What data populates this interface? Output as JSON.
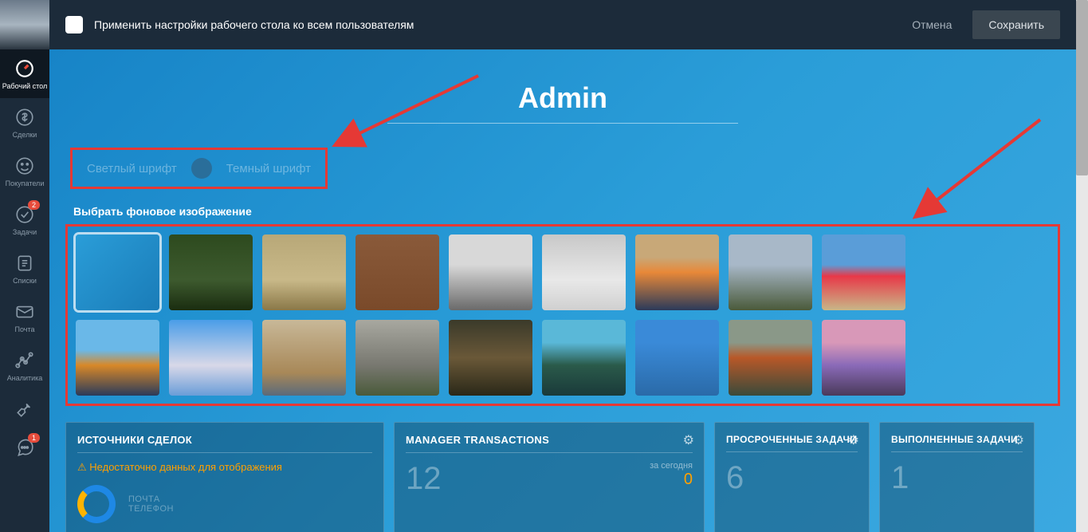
{
  "topbar": {
    "apply_label": "Применить настройки рабочего стола ко всем пользователям",
    "cancel": "Отмена",
    "save": "Сохранить"
  },
  "sidebar": {
    "items": [
      {
        "label": "Рабочий стол",
        "icon": "gauge",
        "active": true
      },
      {
        "label": "Сделки",
        "icon": "dollar"
      },
      {
        "label": "Покупатели",
        "icon": "smile"
      },
      {
        "label": "Задачи",
        "icon": "check",
        "badge": "2"
      },
      {
        "label": "Списки",
        "icon": "list"
      },
      {
        "label": "Почта",
        "icon": "mail"
      },
      {
        "label": "Аналитика",
        "icon": "chart"
      },
      {
        "label": "",
        "icon": "wrench"
      },
      {
        "label": "",
        "icon": "chat",
        "badge": "1"
      }
    ]
  },
  "page": {
    "title": "Admin",
    "font_toggle": {
      "light": "Светлый шрифт",
      "dark": "Темный шрифт"
    },
    "bg_label": "Выбрать фоновое изображение",
    "thumbs": [
      {
        "g": "linear-gradient(135deg,#2a9dd8,#1a7cb8)",
        "selected": true
      },
      {
        "g": "linear-gradient(#2d4a1e,#3d5a2e 60%,#1a2d10)"
      },
      {
        "g": "linear-gradient(#b8a878,#c8b888 60%,#8a7848)"
      },
      {
        "g": "linear-gradient(#8a5a3a,#7a4a2a)"
      },
      {
        "g": "linear-gradient(#d8d8d8 40%,#6a6a6a)"
      },
      {
        "g": "linear-gradient(#c8c8c8,#e8e8e8 60%,#d0d0d0)"
      },
      {
        "g": "linear-gradient(#c8a878 30%,#e88838 50%,#2a3a5a)"
      },
      {
        "g": "linear-gradient(#a8b8c8 40%,#4a5a3a)"
      },
      {
        "g": "linear-gradient(#5a9dd8 40%,#e83848 55%,#c8b888)"
      },
      {
        "g": "linear-gradient(#6ab8e8 40%,#d88828 60%,#2a3a5a)"
      },
      {
        "g": "linear-gradient(#4a9de8,#d8d8e8 60%,#6a9dd8)"
      },
      {
        "g": "linear-gradient(#c8b898,#a88858 70%,#5a6a7a)"
      },
      {
        "g": "linear-gradient(#a8a8a0,#787870 60%,#4a5a3a)"
      },
      {
        "g": "linear-gradient(#3a3a2a,#6a5838 50%,#2a2818)"
      },
      {
        "g": "linear-gradient(#5ab8d8 30%,#2a5a4a 60%,#1a3a3a)"
      },
      {
        "g": "linear-gradient(#3a8ad8 30%,#2a6aa8)"
      },
      {
        "g": "linear-gradient(#8a9888 30%,#b85828 50%,#3a4a3a)"
      },
      {
        "g": "linear-gradient(#d898b8 30%,#8a6ab8 60%,#4a3a5a)"
      }
    ]
  },
  "widgets": {
    "w1": {
      "title": "ИСТОЧНИКИ СДЕЛОК",
      "warn": "Недостаточно данных для отображения",
      "legend1": "ПОЧТА",
      "legend2": "ТЕЛЕФОН"
    },
    "w2": {
      "title": "MANAGER TRANSACTIONS",
      "value": "12",
      "sub": "за сегодня",
      "zero": "0"
    },
    "w3": {
      "title": "ПРОСРОЧЕННЫЕ ЗАДАЧИ",
      "value": "6"
    },
    "w4": {
      "title": "ВЫПОЛНЕННЫЕ ЗАДАЧИ",
      "value": "1"
    }
  }
}
